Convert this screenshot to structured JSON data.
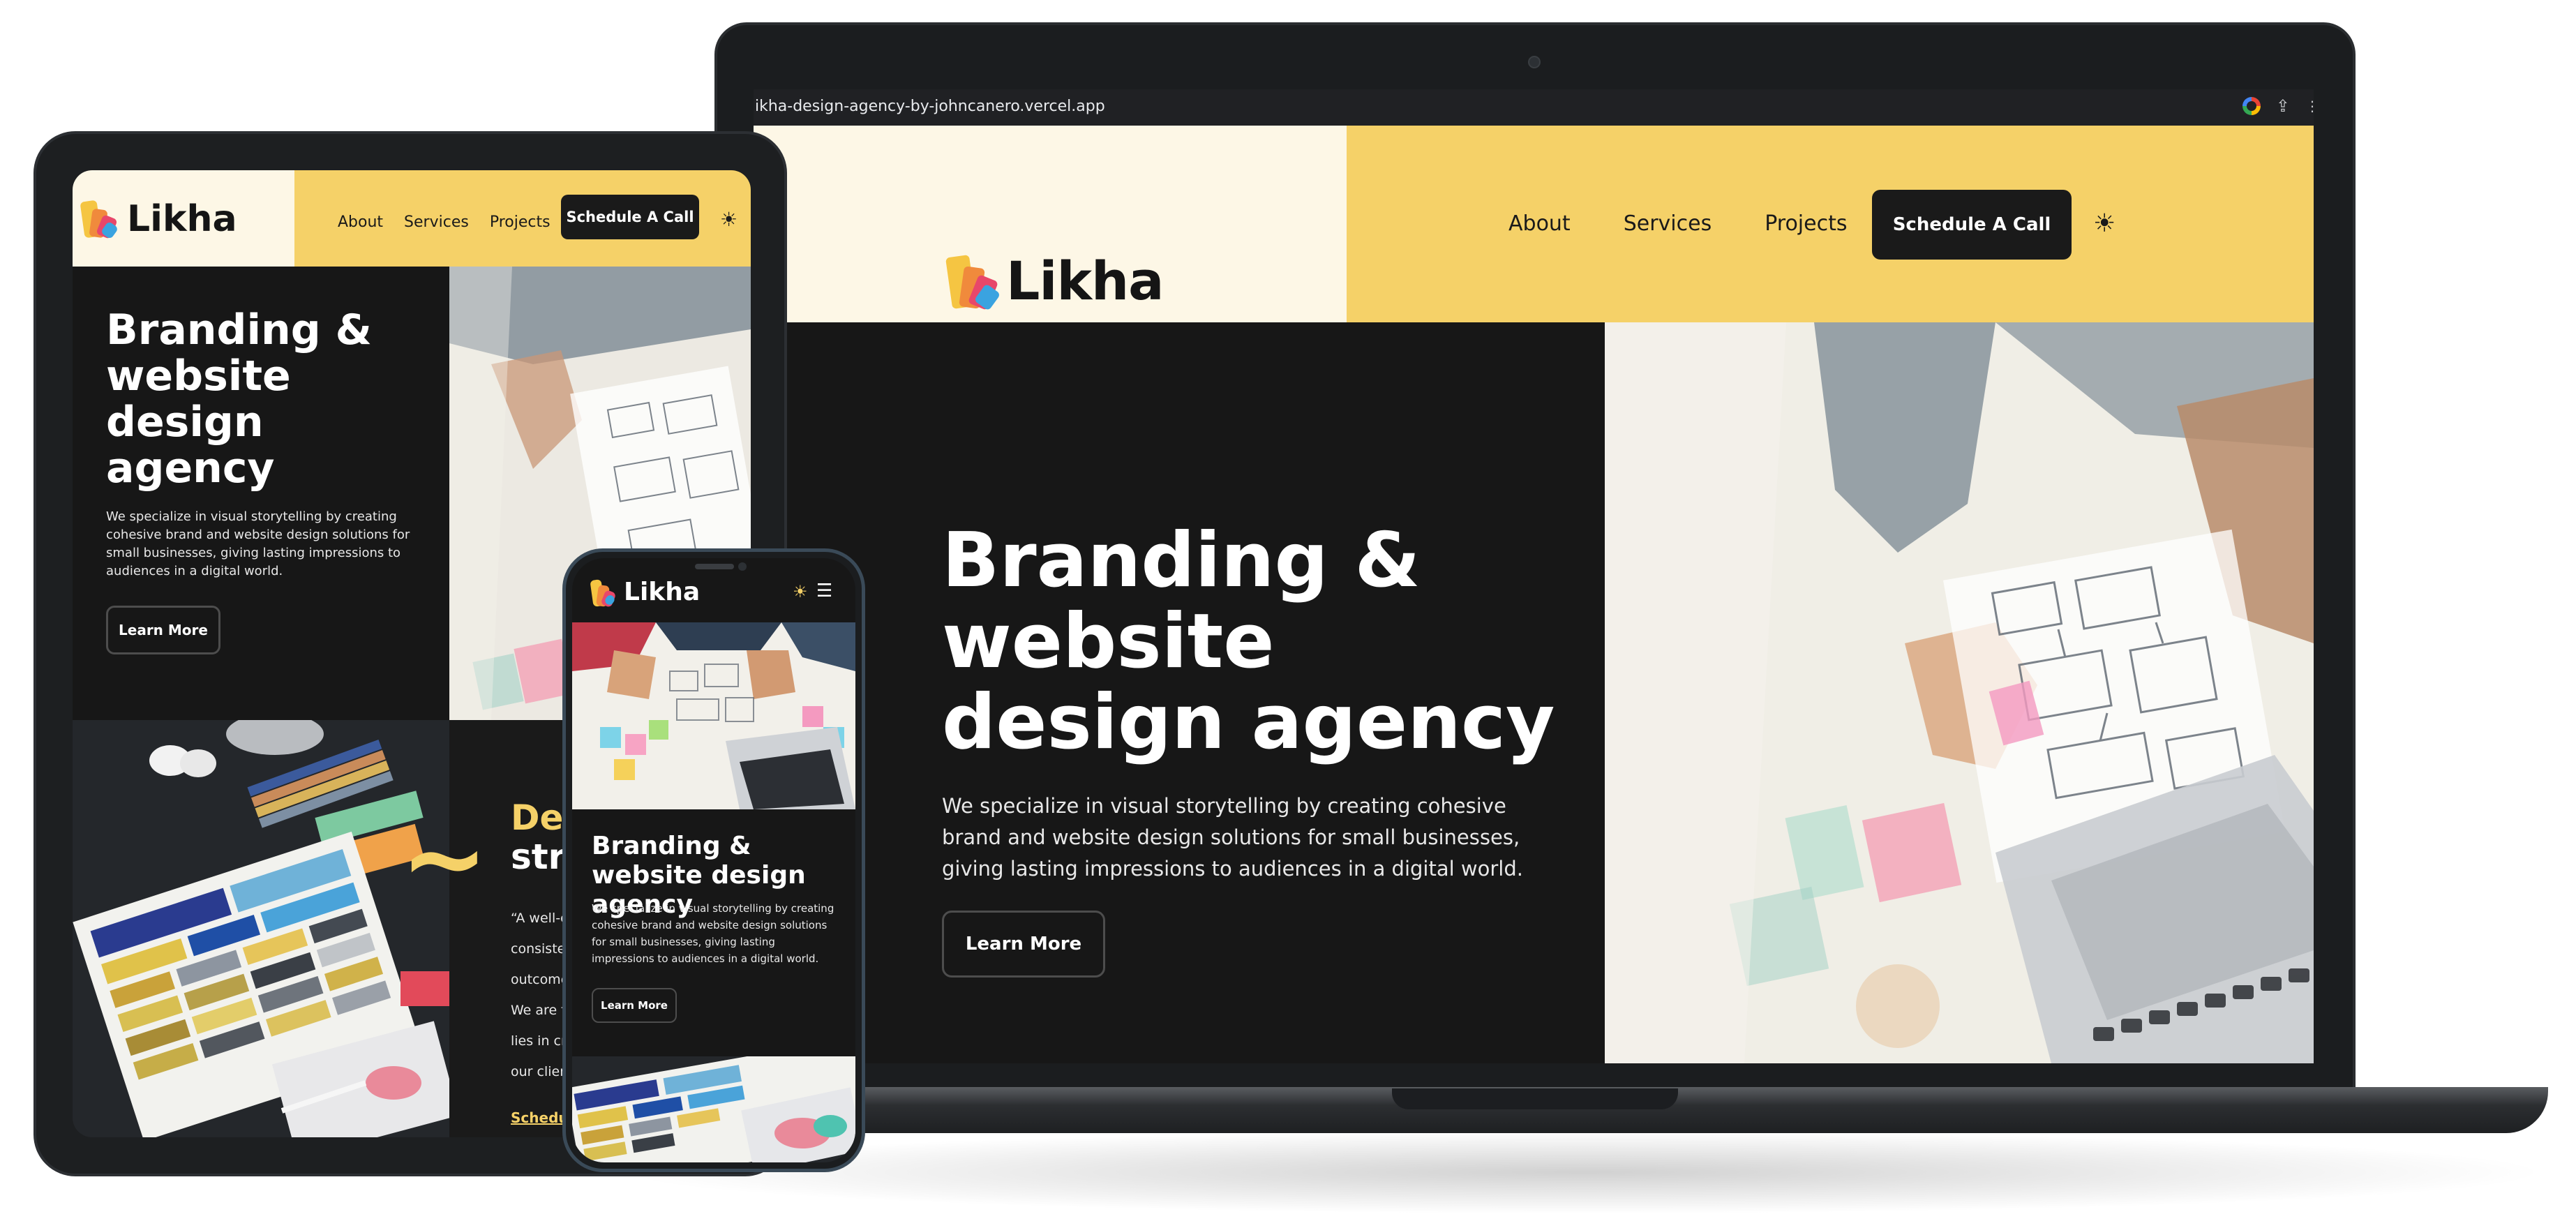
{
  "browser": {
    "url": "likha-design-agency-by-johncanero.vercel.app",
    "url_visible": "ikha-design-agency-by-johncanero.vercel.app"
  },
  "brand": {
    "name": "Likha",
    "colors": {
      "yellow": "#f5d168",
      "cream": "#fdf7e6",
      "dark": "#171717"
    }
  },
  "nav": {
    "links": [
      "About",
      "Services",
      "Projects"
    ],
    "cta": "Schedule A Call",
    "theme_icon": "sun-icon"
  },
  "hero": {
    "title": "Branding & website design agency",
    "description": "We specialize in visual storytelling by creating cohesive brand and website design solutions for small businesses, giving lasting impressions to audiences in a digital world.",
    "button": "Learn More"
  },
  "tablet_section": {
    "title_accent": "Des",
    "title_rest": "stra",
    "quote_lines": [
      "“A well-c",
      "consister",
      "outcome",
      "We are f",
      "lies in cr",
      "our clien"
    ],
    "link": "Schedu"
  },
  "phone": {
    "menu_icon": "hamburger-icon"
  }
}
